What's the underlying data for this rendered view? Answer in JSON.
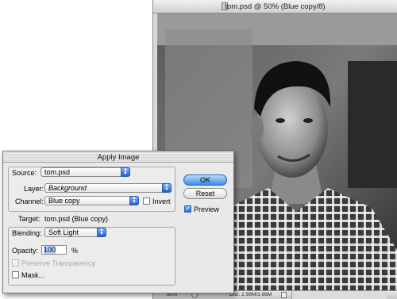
{
  "document": {
    "title": "tom.psd @ 50% (Blue copy/8)",
    "status": {
      "zoom": "50%",
      "doc_size": "Doc: 2.99M/3.98M"
    }
  },
  "dialog": {
    "title": "Apply Image",
    "source": {
      "label": "Source:",
      "value": "tom.psd"
    },
    "layer": {
      "label": "Layer:",
      "value": "Background"
    },
    "channel": {
      "label": "Channel:",
      "value": "Blue copy"
    },
    "invert": {
      "label": "Invert",
      "checked": false
    },
    "target": {
      "label": "Target:",
      "value": "tom.psd (Blue copy)"
    },
    "blending": {
      "label": "Blending:",
      "value": "Soft Light"
    },
    "opacity": {
      "label": "Opacity:",
      "value": "100",
      "unit": "%"
    },
    "preserve_transparency": {
      "label": "Preserve Transparency",
      "checked": false,
      "enabled": false
    },
    "mask": {
      "label": "Mask...",
      "checked": false
    },
    "buttons": {
      "ok": "OK",
      "reset": "Reset"
    },
    "preview": {
      "label": "Preview",
      "checked": true
    }
  },
  "colors": {
    "accent": "#3c8ae8",
    "dialog_bg": "#e9e9e9"
  }
}
